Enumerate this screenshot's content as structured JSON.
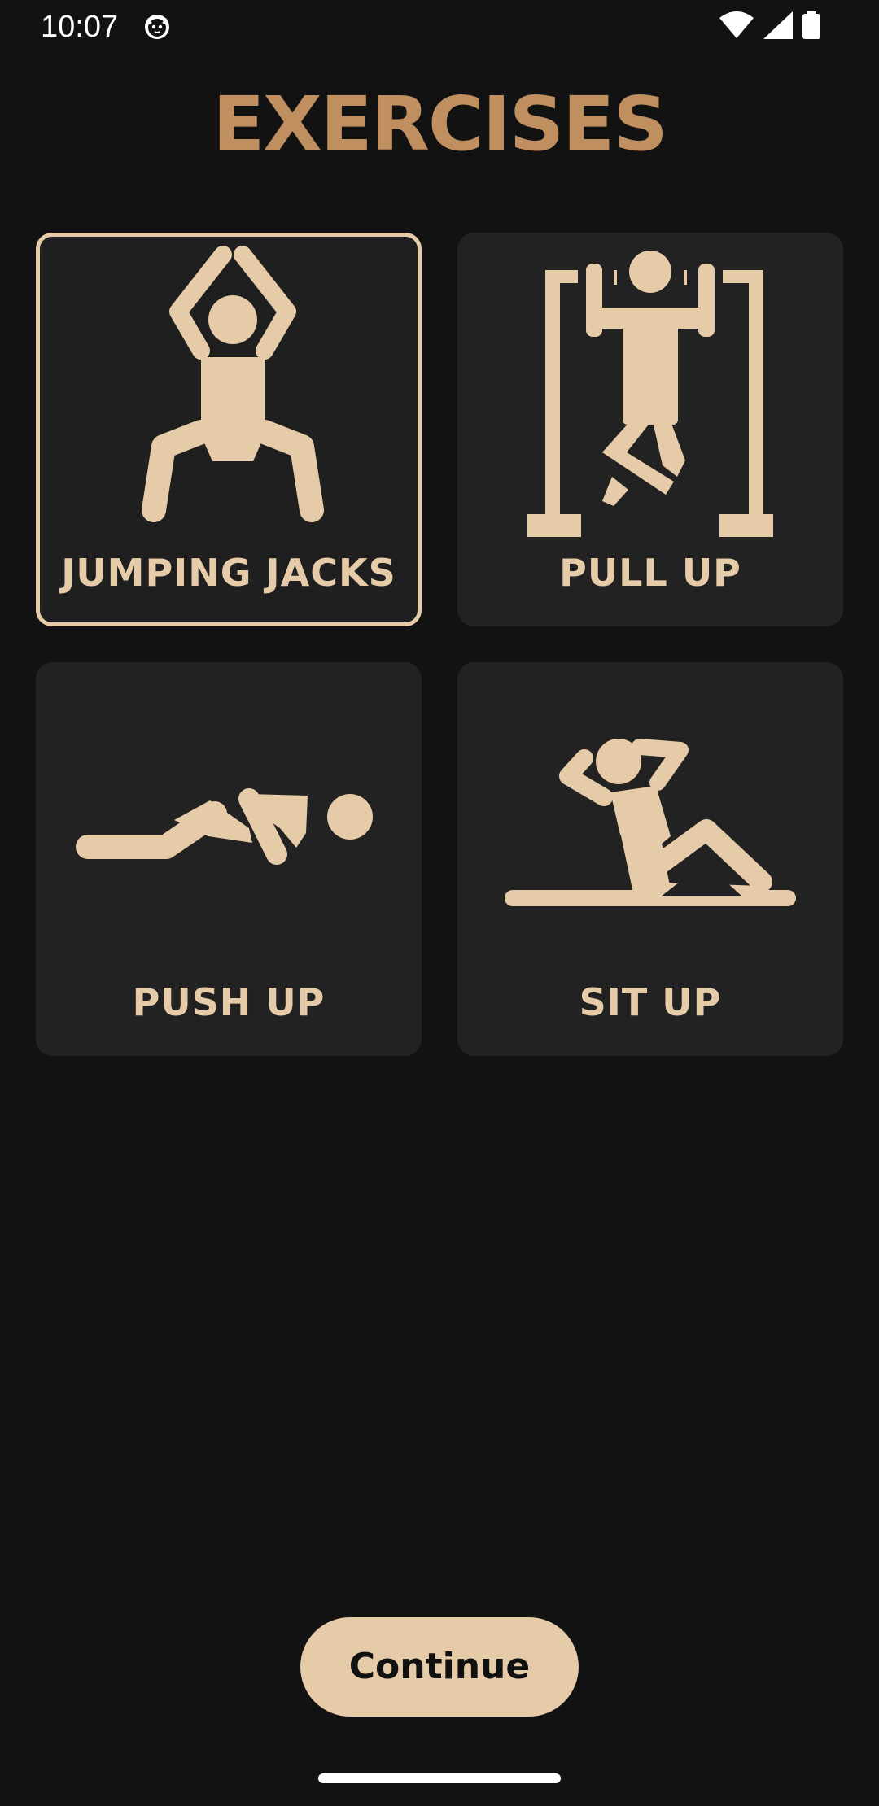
{
  "status_bar": {
    "time": "10:07",
    "icons": [
      "cat-face-icon",
      "wifi-icon",
      "signal-icon",
      "battery-icon"
    ]
  },
  "title": "EXERCISES",
  "colors": {
    "background": "#121212",
    "card": "#222222",
    "accent": "#e6cba9",
    "title": "#c08f60"
  },
  "exercises": [
    {
      "label": "JUMPING JACKS",
      "icon": "jumping-jacks-icon",
      "selected": true
    },
    {
      "label": "PULL UP",
      "icon": "pull-up-icon",
      "selected": false
    },
    {
      "label": "PUSH UP",
      "icon": "push-up-icon",
      "selected": false
    },
    {
      "label": "SIT UP",
      "icon": "sit-up-icon",
      "selected": false
    }
  ],
  "continue_label": "Continue"
}
